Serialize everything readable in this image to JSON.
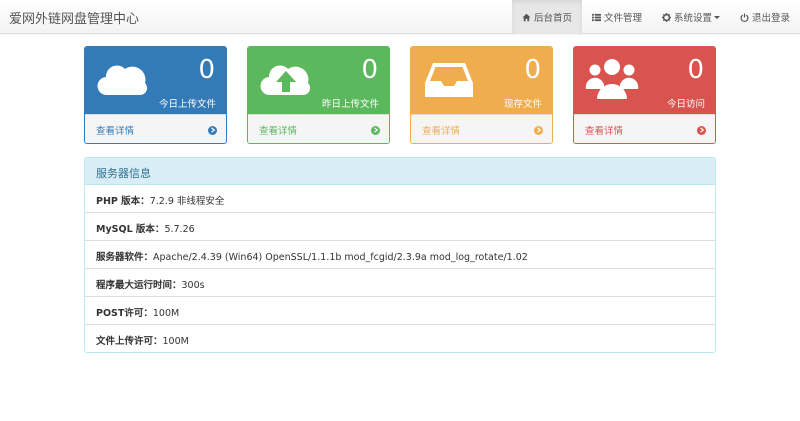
{
  "app": {
    "title": "爱网外链网盘管理中心"
  },
  "nav": [
    {
      "label": "后台首页",
      "icon": "home-icon",
      "active": true
    },
    {
      "label": "文件管理",
      "icon": "list-icon"
    },
    {
      "label": "系统设置",
      "icon": "gear-icon",
      "dropdown": true
    },
    {
      "label": "退出登录",
      "icon": "power-icon"
    }
  ],
  "panels": [
    {
      "count": "0",
      "label": "今日上传文件",
      "link": "查看详情",
      "icon": "cloud-icon",
      "color": "#337ab7"
    },
    {
      "count": "0",
      "label": "昨日上传文件",
      "link": "查看详情",
      "icon": "cloud-upload-icon",
      "color": "#5cb85c"
    },
    {
      "count": "0",
      "label": "现存文件",
      "link": "查看详情",
      "icon": "inbox-icon",
      "color": "#f0ad4e"
    },
    {
      "count": "0",
      "label": "今日访问",
      "link": "查看详情",
      "icon": "users-icon",
      "color": "#d9534f"
    }
  ],
  "server_info": {
    "title": "服务器信息",
    "rows": [
      {
        "key": "PHP 版本：",
        "value": "7.2.9 非线程安全"
      },
      {
        "key": "MySQL 版本：",
        "value": "5.7.26"
      },
      {
        "key": "服务器软件：",
        "value": "Apache/2.4.39 (Win64) OpenSSL/1.1.1b mod_fcgid/2.3.9a mod_log_rotate/1.02"
      },
      {
        "key": "程序最大运行时间：",
        "value": "300s"
      },
      {
        "key": "POST许可：",
        "value": "100M"
      },
      {
        "key": "文件上传许可：",
        "value": "100M"
      }
    ]
  }
}
